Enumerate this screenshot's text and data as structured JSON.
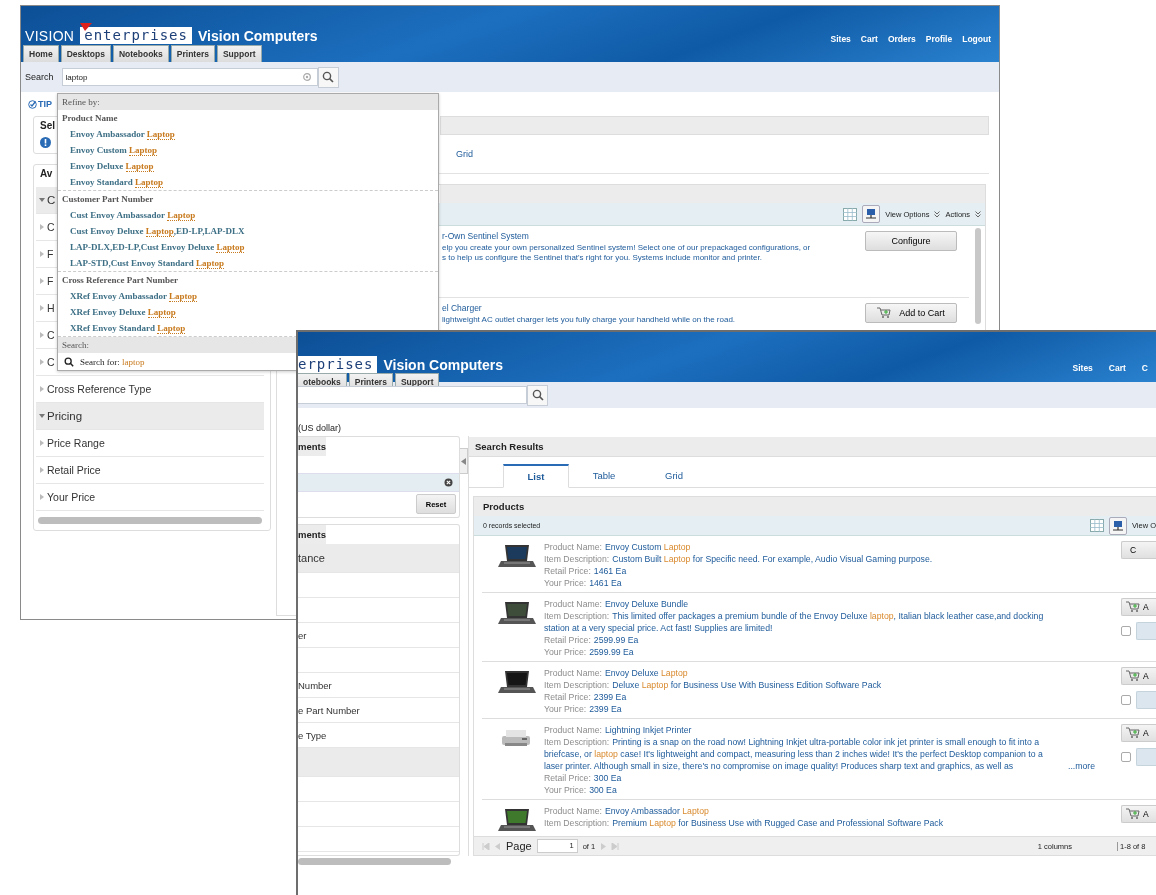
{
  "back_window": {
    "brand": {
      "word": "VISION",
      "box": "enterprises",
      "title": "Vision Computers"
    },
    "top_links": [
      "Sites",
      "Cart",
      "Orders",
      "Profile",
      "Logout"
    ],
    "tabs": [
      "Home",
      "Desktops",
      "Notebooks",
      "Printers",
      "Support"
    ],
    "search": {
      "label": "Search",
      "value": "laptop"
    },
    "tip": "TIP",
    "selected_panel_title": "Sel",
    "available_panel_title": "Av",
    "filters": [
      {
        "kind": "group",
        "label": "C",
        "expanded": true
      },
      {
        "kind": "item",
        "label": "C"
      },
      {
        "kind": "item",
        "label": "F"
      },
      {
        "kind": "item",
        "label": "F"
      },
      {
        "kind": "item",
        "label": "H"
      },
      {
        "kind": "item",
        "label": "C"
      },
      {
        "kind": "item",
        "label": "C"
      },
      {
        "kind": "item",
        "label": "Cross Reference Type"
      },
      {
        "kind": "group",
        "label": "Pricing",
        "expanded": true
      },
      {
        "kind": "item",
        "label": "Price Range"
      },
      {
        "kind": "item",
        "label": "Retail Price"
      },
      {
        "kind": "item",
        "label": "Your Price"
      }
    ],
    "view_tab": "Grid",
    "view_options": "View Options",
    "actions": "Actions",
    "results": [
      {
        "name": "r-Own Sentinel System",
        "description": [
          "elp you create your own personalized Sentinel system! Select one of our prepackaged configurations, or",
          "s to help us configure the Sentinel that's right for you.  Systems include monitor and printer."
        ],
        "action": {
          "kind": "configure",
          "label": "Configure"
        }
      },
      {
        "name": "el Charger",
        "description": [
          "lightweight AC outlet charger lets you fully charge your handheld while on the road."
        ],
        "action": {
          "kind": "cart",
          "label": "Add to Cart"
        }
      }
    ],
    "dropdown": {
      "heading": "Refine by:",
      "groups": [
        {
          "title": "Product Name",
          "items": [
            [
              {
                "text": "Envoy Ambassador ",
                "match": false
              },
              {
                "text": "Laptop",
                "match": true
              }
            ],
            [
              {
                "text": "Envoy Custom ",
                "match": false
              },
              {
                "text": "Laptop",
                "match": true
              }
            ],
            [
              {
                "text": "Envoy Deluxe ",
                "match": false
              },
              {
                "text": "Laptop",
                "match": true
              }
            ],
            [
              {
                "text": "Envoy Standard ",
                "match": false
              },
              {
                "text": "Laptop",
                "match": true
              }
            ]
          ]
        },
        {
          "title": "Customer Part Number",
          "items": [
            [
              {
                "text": "Cust Envoy Ambassador ",
                "match": false
              },
              {
                "text": "Laptop",
                "match": true
              }
            ],
            [
              {
                "text": "Cust Envoy Deluxe ",
                "match": false
              },
              {
                "text": "Laptop",
                "match": true
              },
              {
                "text": ",ED-LP,LAP-DLX",
                "match": false
              }
            ],
            [
              {
                "text": "LAP-DLX,ED-LP,Cust Envoy Deluxe ",
                "match": false
              },
              {
                "text": "Laptop",
                "match": true
              }
            ],
            [
              {
                "text": "LAP-STD,Cust Envoy Standard ",
                "match": false
              },
              {
                "text": "Laptop",
                "match": true
              }
            ]
          ]
        },
        {
          "title": "Cross Reference Part Number",
          "items": [
            [
              {
                "text": "XRef Envoy Ambassador ",
                "match": false
              },
              {
                "text": "Laptop",
                "match": true
              }
            ],
            [
              {
                "text": "XRef Envoy Deluxe ",
                "match": false
              },
              {
                "text": "Laptop",
                "match": true
              }
            ],
            [
              {
                "text": "XRef Envoy Standard ",
                "match": false
              },
              {
                "text": "Laptop",
                "match": true
              }
            ]
          ]
        }
      ],
      "search_heading": "Search:",
      "search_for": [
        {
          "text": "Search for: ",
          "match": false
        },
        {
          "text": "laptop",
          "match": true
        }
      ]
    }
  },
  "front_window": {
    "brand": {
      "box": "erprises",
      "title": "Vision Computers"
    },
    "top_links": [
      "Sites",
      "Cart",
      "C"
    ],
    "tabs": [
      "otebooks",
      "Printers",
      "Support"
    ],
    "currency": "(US dollar)",
    "refine_title": "ments",
    "reset": "Reset",
    "browse_title": "ments",
    "browse_rows": [
      {
        "kind": "group",
        "label": "tance"
      },
      {
        "kind": "item"
      },
      {
        "kind": "item"
      },
      {
        "kind": "item",
        "label": "er"
      },
      {
        "kind": "item"
      },
      {
        "kind": "item",
        "label": "Number"
      },
      {
        "kind": "item",
        "label": "e Part Number"
      },
      {
        "kind": "item",
        "label": "e Type"
      },
      {
        "kind": "group"
      },
      {
        "kind": "item"
      },
      {
        "kind": "item"
      },
      {
        "kind": "item"
      }
    ],
    "results_title": "Search Results",
    "view_tabs": [
      {
        "label": "List",
        "selected": true
      },
      {
        "label": "Table",
        "selected": false
      },
      {
        "label": "Grid",
        "selected": false
      }
    ],
    "products_title": "Products",
    "records": "0 records selected",
    "view_options": "View O",
    "products": [
      {
        "name_label": "Product Name:",
        "name": [
          {
            "text": "Envoy Custom ",
            "match": false
          },
          {
            "text": "Laptop",
            "match": true
          }
        ],
        "description_label": "Item Description:",
        "description": [
          {
            "text": "Custom Built ",
            "match": false
          },
          {
            "text": "Laptop",
            "match": true
          },
          {
            "text": " for Specific need. For example, Audio Visual Gaming purpose.",
            "match": false
          }
        ],
        "retail_label": "Retail Price:",
        "retail": "1461 Ea",
        "your_label": "Your Price:",
        "your": "1461 Ea",
        "action": {
          "kind": "configure",
          "label": "C"
        }
      },
      {
        "name_label": "Product Name:",
        "name": [
          {
            "text": "Envoy Deluxe Bundle",
            "match": false
          }
        ],
        "description_label": "Item Description:",
        "description": [
          {
            "text": "This limited offer packages a premium bundle of the Envoy Deluxe ",
            "match": false
          },
          {
            "text": "laptop",
            "match": true
          },
          {
            "text": ",  Italian black leather case,and docking station at a very special price.  Act fast! Supplies are limited!",
            "match": false
          }
        ],
        "retail_label": "Retail Price:",
        "retail": "2599.99 Ea",
        "your_label": "Your Price:",
        "your": "2599.99 Ea",
        "action": {
          "kind": "cart",
          "label": "A",
          "checked": false
        }
      },
      {
        "name_label": "Product Name:",
        "name": [
          {
            "text": "Envoy Deluxe ",
            "match": false
          },
          {
            "text": "Laptop",
            "match": true
          }
        ],
        "description_label": "Item Description:",
        "description": [
          {
            "text": "Deluxe ",
            "match": false
          },
          {
            "text": "Laptop",
            "match": true
          },
          {
            "text": " for Business Use With Business Edition Software Pack",
            "match": false
          }
        ],
        "retail_label": "Retail Price:",
        "retail": "2399 Ea",
        "your_label": "Your Price:",
        "your": "2399 Ea",
        "action": {
          "kind": "cart",
          "label": "A",
          "checked": false
        }
      },
      {
        "name_label": "Product Name:",
        "name": [
          {
            "text": "Lightning Inkjet Printer",
            "match": false
          }
        ],
        "description_label": "Item Description:",
        "description": [
          {
            "text": "Printing is a snap on the road now! Lightning Inkjet ultra-portable color  ink jet printer is small enough to fit into a briefcase, or ",
            "match": false
          },
          {
            "text": "laptop",
            "match": true
          },
          {
            "text": " case!  It's lightweight and compact, measuring less than 2 inches wide!  It's the perfect Desktop companion to a laser printer. Although small in  size, there's no compromise on image quality! Produces sharp text and  graphics, as well as",
            "match": false
          }
        ],
        "more": "...more",
        "retail_label": "Retail Price:",
        "retail": "300 Ea",
        "your_label": "Your Price:",
        "your": "300 Ea",
        "action": {
          "kind": "cart",
          "label": "A",
          "checked": false
        }
      },
      {
        "name_label": "Product Name:",
        "name": [
          {
            "text": "Envoy Ambassador ",
            "match": false
          },
          {
            "text": "Laptop",
            "match": true
          }
        ],
        "description_label": "Item Description:",
        "description": [
          {
            "text": "Premium ",
            "match": false
          },
          {
            "text": "Laptop",
            "match": true
          },
          {
            "text": " for Business Use with Rugged Case and Professional Software Pack",
            "match": false
          }
        ],
        "action": {
          "kind": "cart",
          "label": "A"
        }
      }
    ],
    "pager": {
      "label": "Page",
      "value": "1",
      "of": "of 1",
      "columns": "1 columns",
      "range": "1-8 of 8"
    }
  }
}
